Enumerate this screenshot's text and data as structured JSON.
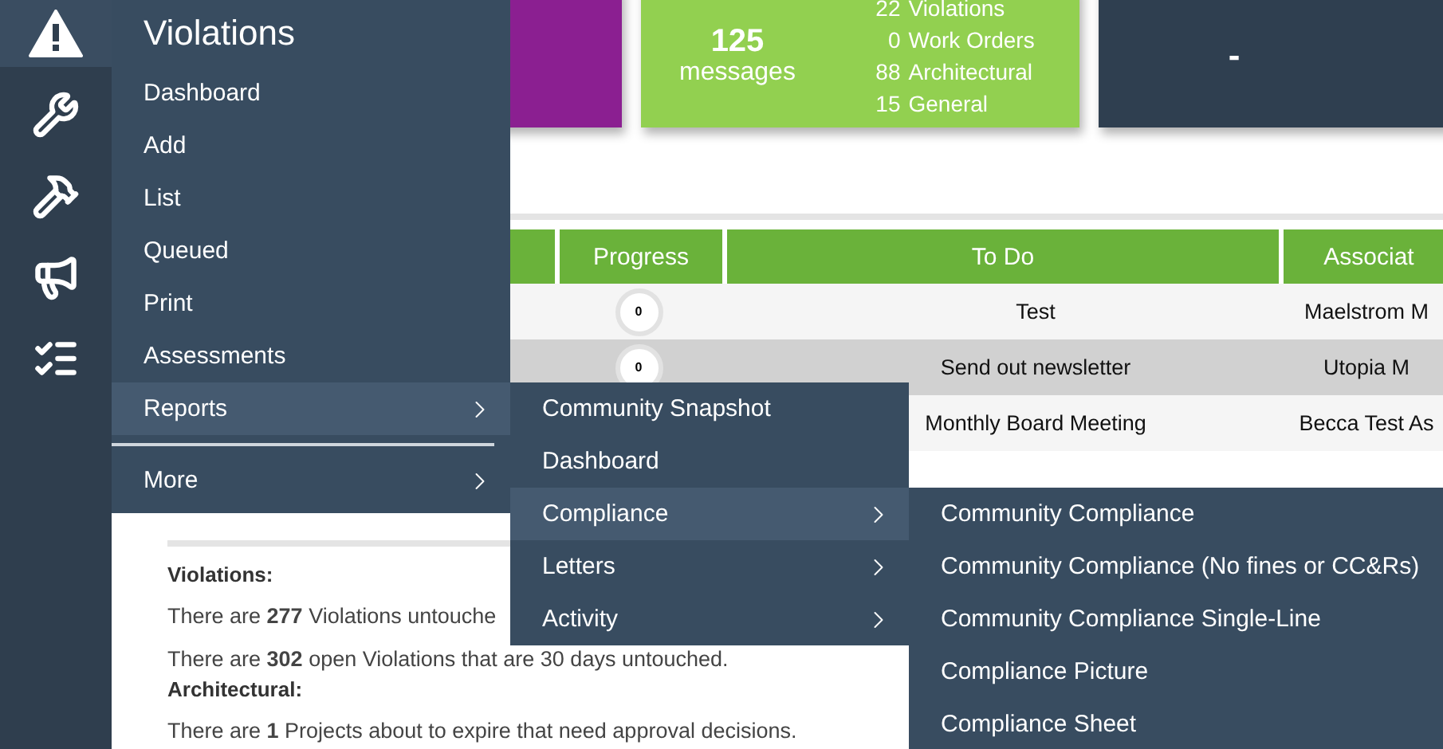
{
  "sidebar": {
    "items": [
      {
        "kind": "warning",
        "selected": true
      },
      {
        "kind": "wrench",
        "selected": false
      },
      {
        "kind": "hammer",
        "selected": false
      },
      {
        "kind": "megaphone",
        "selected": false
      },
      {
        "kind": "checklist",
        "selected": false
      }
    ]
  },
  "cards": [
    {
      "kind": "blank",
      "color": "#8b1f91"
    },
    {
      "kind": "messages",
      "color": "#92d050",
      "count": "125",
      "unit": "messages",
      "lines": [
        {
          "count": "22",
          "label": "Violations"
        },
        {
          "count": "0",
          "label": "Work Orders"
        },
        {
          "count": "88",
          "label": "Architectural"
        },
        {
          "count": "15",
          "label": "General"
        }
      ]
    },
    {
      "kind": "value",
      "color": "#2f3f50",
      "value": "-"
    }
  ],
  "table": {
    "columns": [
      "Progress",
      "To Do",
      "Associat"
    ],
    "rows": [
      {
        "progress": "0",
        "todo": "Test",
        "association": "Maelstrom M"
      },
      {
        "progress": "0",
        "todo": "Send out newsletter",
        "association": "Utopia M"
      },
      {
        "todo": "Monthly Board Meeting",
        "association": "Becca Test As"
      }
    ]
  },
  "prescriptive": {
    "sections": [
      {
        "heading": "Violations:",
        "lines": [
          "There are **277** Violations untouche",
          "There are **302** open Violations that are 30 days untouched."
        ]
      },
      {
        "heading": "Architectural:",
        "lines": [
          "There are **1** Projects about to expire that need approval decisions."
        ]
      }
    ]
  },
  "menu": {
    "title": "Violations",
    "items": [
      {
        "label": "Dashboard",
        "selected": false,
        "expandable": false
      },
      {
        "label": "Add",
        "selected": false,
        "expandable": false
      },
      {
        "label": "List",
        "selected": false,
        "expandable": false
      },
      {
        "label": "Queued",
        "selected": false,
        "expandable": false
      },
      {
        "label": "Print",
        "selected": false,
        "expandable": false
      },
      {
        "label": "Assessments",
        "selected": false,
        "expandable": false
      },
      {
        "label": "Reports",
        "selected": true,
        "expandable": true,
        "children": [
          {
            "label": "Community Snapshot",
            "selected": false,
            "expandable": false
          },
          {
            "label": "Dashboard",
            "selected": false,
            "expandable": false
          },
          {
            "label": "Compliance",
            "selected": true,
            "expandable": true,
            "children": [
              {
                "label": "Community Compliance",
                "selected": false,
                "expandable": false
              },
              {
                "label": "Community Compliance (No fines or CC&Rs)",
                "selected": false,
                "expandable": false
              },
              {
                "label": "Community Compliance Single-Line",
                "selected": false,
                "expandable": false
              },
              {
                "label": "Compliance Picture",
                "selected": false,
                "expandable": false
              },
              {
                "label": "Compliance Sheet",
                "selected": false,
                "expandable": false
              }
            ]
          },
          {
            "label": "Letters",
            "selected": false,
            "expandable": true
          },
          {
            "label": "Activity",
            "selected": false,
            "expandable": true
          }
        ]
      },
      {
        "label": "More",
        "selected": false,
        "expandable": true,
        "divider_before": true
      }
    ]
  }
}
